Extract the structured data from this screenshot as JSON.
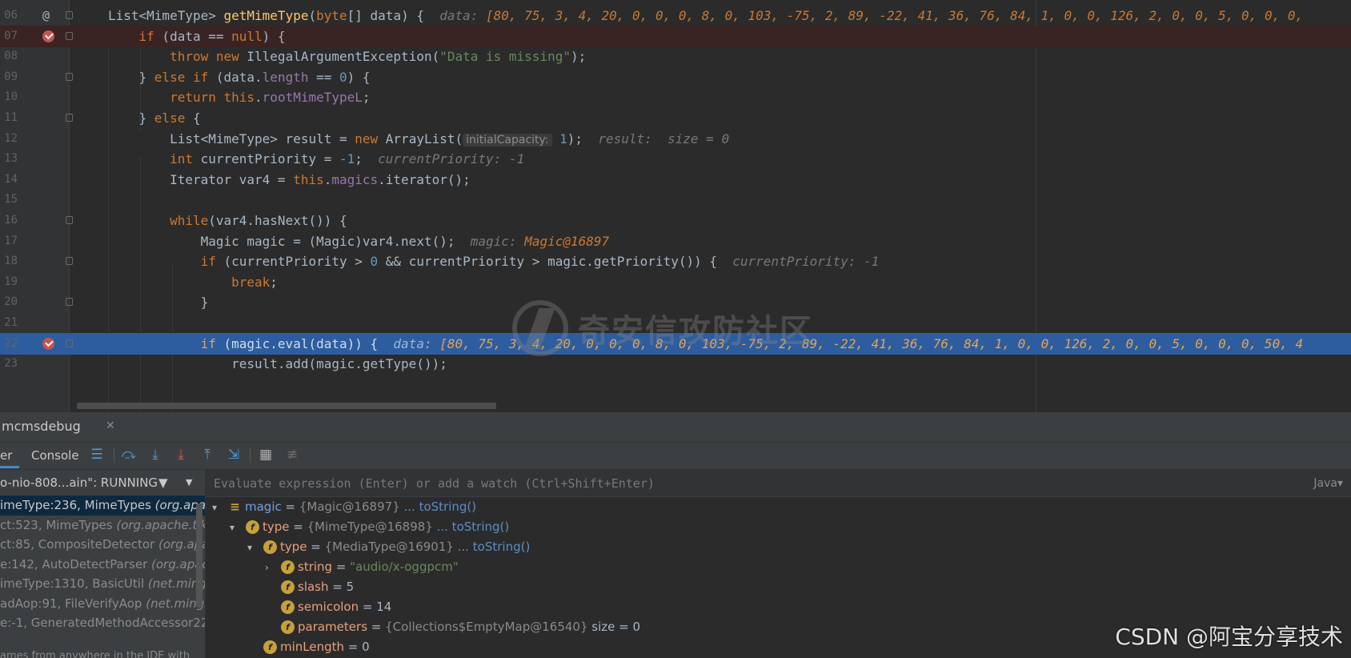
{
  "editor": {
    "lines": [
      {
        "num": "06",
        "type": "plain",
        "html_parts": [
          {
            "t": "List<MimeType> ",
            "c": ""
          },
          {
            "t": "getMimeType",
            "c": "fn"
          },
          {
            "t": "(",
            "c": ""
          },
          {
            "t": "byte",
            "c": "kw"
          },
          {
            "t": "[] data) {  ",
            "c": ""
          },
          {
            "t": "data: ",
            "c": "hint"
          },
          {
            "t": "[80, 75, 3, 4, 20, 0, 0, 0, 8, 0, 103, -75, 2, 89, -22, 41, 36, 76, 84, 1, 0, 0, 126, 2, 0, 0, 5, 0, 0, 0,",
            "c": "hv"
          }
        ]
      },
      {
        "num": "07",
        "type": "bp",
        "html_parts": [
          {
            "t": "    ",
            "c": ""
          },
          {
            "t": "if",
            "c": "kw"
          },
          {
            "t": " (data == ",
            "c": ""
          },
          {
            "t": "null",
            "c": "kw"
          },
          {
            "t": ") {",
            "c": ""
          }
        ]
      },
      {
        "num": "08",
        "type": "plain",
        "html_parts": [
          {
            "t": "        ",
            "c": ""
          },
          {
            "t": "throw new",
            "c": "kw"
          },
          {
            "t": " IllegalArgumentException(",
            "c": ""
          },
          {
            "t": "\"Data is missing\"",
            "c": "str"
          },
          {
            "t": ");",
            "c": ""
          }
        ]
      },
      {
        "num": "09",
        "type": "plain",
        "html_parts": [
          {
            "t": "    } ",
            "c": ""
          },
          {
            "t": "else if",
            "c": "kw"
          },
          {
            "t": " (data.",
            "c": ""
          },
          {
            "t": "length",
            "c": "fld"
          },
          {
            "t": " == ",
            "c": ""
          },
          {
            "t": "0",
            "c": "num"
          },
          {
            "t": ") {",
            "c": ""
          }
        ]
      },
      {
        "num": "10",
        "type": "plain",
        "html_parts": [
          {
            "t": "        ",
            "c": ""
          },
          {
            "t": "return this",
            "c": "kw"
          },
          {
            "t": ".",
            "c": ""
          },
          {
            "t": "rootMimeTypeL",
            "c": "fld"
          },
          {
            "t": ";",
            "c": ""
          }
        ]
      },
      {
        "num": "11",
        "type": "plain",
        "html_parts": [
          {
            "t": "    } ",
            "c": ""
          },
          {
            "t": "else",
            "c": "kw"
          },
          {
            "t": " {",
            "c": ""
          }
        ]
      },
      {
        "num": "12",
        "type": "plain",
        "html_parts": [
          {
            "t": "        List<MimeType> result = ",
            "c": ""
          },
          {
            "t": "new",
            "c": "kw"
          },
          {
            "t": " ArrayList(",
            "c": ""
          },
          {
            "t": "initialCapacity:",
            "c": "param-hint"
          },
          {
            "t": " 1",
            "c": "num"
          },
          {
            "t": ");  ",
            "c": ""
          },
          {
            "t": "result:  size = 0",
            "c": "hint"
          }
        ]
      },
      {
        "num": "13",
        "type": "plain",
        "html_parts": [
          {
            "t": "        ",
            "c": ""
          },
          {
            "t": "int",
            "c": "kw"
          },
          {
            "t": " currentPriority = ",
            "c": ""
          },
          {
            "t": "-1",
            "c": "num"
          },
          {
            "t": ";  ",
            "c": ""
          },
          {
            "t": "currentPriority: -1",
            "c": "hint"
          }
        ]
      },
      {
        "num": "14",
        "type": "plain",
        "html_parts": [
          {
            "t": "        Iterator var4 = ",
            "c": ""
          },
          {
            "t": "this",
            "c": "kw"
          },
          {
            "t": ".",
            "c": ""
          },
          {
            "t": "magics",
            "c": "fld"
          },
          {
            "t": ".iterator();",
            "c": ""
          }
        ]
      },
      {
        "num": "15",
        "type": "plain",
        "html_parts": []
      },
      {
        "num": "16",
        "type": "plain",
        "html_parts": [
          {
            "t": "        ",
            "c": ""
          },
          {
            "t": "while",
            "c": "kw"
          },
          {
            "t": "(var4.hasNext()) {",
            "c": ""
          }
        ]
      },
      {
        "num": "17",
        "type": "plain",
        "html_parts": [
          {
            "t": "            Magic magic = (Magic)var4.next();  ",
            "c": ""
          },
          {
            "t": "magic: ",
            "c": "hint"
          },
          {
            "t": "Magic@16897",
            "c": "hv"
          }
        ]
      },
      {
        "num": "18",
        "type": "plain",
        "html_parts": [
          {
            "t": "            ",
            "c": ""
          },
          {
            "t": "if",
            "c": "kw"
          },
          {
            "t": " (currentPriority > ",
            "c": ""
          },
          {
            "t": "0",
            "c": "num"
          },
          {
            "t": " && currentPriority > magic.getPriority()) {  ",
            "c": ""
          },
          {
            "t": "currentPriority: -1",
            "c": "hint"
          }
        ]
      },
      {
        "num": "19",
        "type": "plain",
        "html_parts": [
          {
            "t": "                ",
            "c": ""
          },
          {
            "t": "break",
            "c": "kw"
          },
          {
            "t": ";",
            "c": ""
          }
        ]
      },
      {
        "num": "20",
        "type": "plain",
        "html_parts": [
          {
            "t": "            }",
            "c": ""
          }
        ]
      },
      {
        "num": "21",
        "type": "plain",
        "html_parts": []
      },
      {
        "num": "22",
        "type": "exec",
        "html_parts": [
          {
            "t": "            ",
            "c": ""
          },
          {
            "t": "if",
            "c": "kw"
          },
          {
            "t": " (magic.eval(data)) {  ",
            "c": ""
          },
          {
            "t": "data: ",
            "c": "hint"
          },
          {
            "t": "[80, 75, 3, 4, 20, 0, 0, 0, 8, 0, 103, -75, 2, 89, -22, 41, 36, 76, 84, 1, 0, 0, 126, 2, 0, 0, 5, 0, 0, 0, 50, 4",
            "c": "hv"
          }
        ]
      },
      {
        "num": "23",
        "type": "plain",
        "html_parts": [
          {
            "t": "                result.add(magic.getType());",
            "c": ""
          }
        ]
      }
    ],
    "watermark": "奇安信攻防社区"
  },
  "panel": {
    "tab_title": "mcmsdebug",
    "tab_close": "✕",
    "toolbar_tabs": [
      "er",
      "Console"
    ],
    "thread": "o-nio-808...ain\": RUNNING",
    "frames": [
      {
        "method": "imeType:236, MimeTypes ",
        "cls": "(org.apa",
        "selected": true
      },
      {
        "method": "ct:523, MimeTypes ",
        "cls": "(org.apache.tika",
        "selected": false
      },
      {
        "method": "ct:85, CompositeDetector ",
        "cls": "(org.apac",
        "selected": false
      },
      {
        "method": "e:142, AutoDetectParser ",
        "cls": "(org.apach",
        "selected": false
      },
      {
        "method": "imeType:1310, BasicUtil ",
        "cls": "(net.mings",
        "selected": false
      },
      {
        "method": "adAop:91, FileVerifyAop ",
        "cls": "(net.mings",
        "selected": false
      },
      {
        "method": "e:-1, GeneratedMethodAccessor22",
        "cls": "",
        "selected": false
      }
    ],
    "frames_hint": "ames from anywhere in the IDE with",
    "eval_placeholder": "Evaluate expression (Enter) or add a watch (Ctrl+Shift+Enter)",
    "eval_lang": "Java▾",
    "variables": [
      {
        "indent": 0,
        "chev": "▾",
        "icon": "≡",
        "icon_kind": "local",
        "name": "magic",
        "value": "{Magic@16897}",
        "link": " ... toString()",
        "vclass": "vval"
      },
      {
        "indent": 1,
        "chev": "▾",
        "icon": "f",
        "icon_kind": "field",
        "name": "type",
        "value": "{MimeType@16898}",
        "link": " ... toString()",
        "vclass": "vval"
      },
      {
        "indent": 2,
        "chev": "▾",
        "icon": "f",
        "icon_kind": "field",
        "name": "type",
        "value": "{MediaType@16901}",
        "link": " ... toString()",
        "vclass": "vval"
      },
      {
        "indent": 3,
        "chev": "›",
        "icon": "f",
        "icon_kind": "field",
        "name": "string",
        "value": "\"audio/x-oggpcm\"",
        "link": "",
        "vclass": "vstr"
      },
      {
        "indent": 3,
        "chev": "",
        "icon": "f",
        "icon_kind": "field",
        "name": "slash",
        "value": "5",
        "link": "",
        "vclass": "vnum"
      },
      {
        "indent": 3,
        "chev": "",
        "icon": "f",
        "icon_kind": "field",
        "name": "semicolon",
        "value": "14",
        "link": "",
        "vclass": "vnum"
      },
      {
        "indent": 3,
        "chev": "",
        "icon": "f",
        "icon_kind": "field",
        "name": "parameters",
        "value": "{Collections$EmptyMap@16540}",
        "link": "  size = 0",
        "vclass": "vval"
      },
      {
        "indent": 2,
        "chev": "",
        "icon": "f",
        "icon_kind": "field",
        "name": "minLength",
        "value": "0",
        "link": "",
        "vclass": "vnum"
      }
    ]
  },
  "watermark_csdn": "CSDN @阿宝分享技术"
}
